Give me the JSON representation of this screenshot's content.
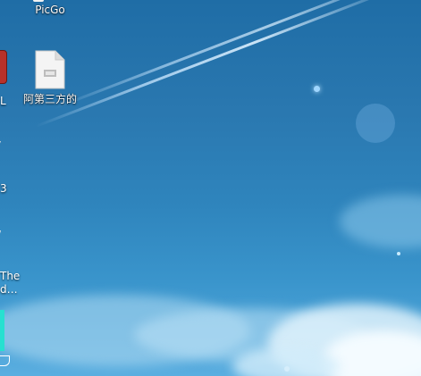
{
  "desktop": {
    "icons": [
      {
        "label": "PicGo",
        "icon": "picgo-icon"
      },
      {
        "label": "阿第三方的",
        "icon": "file-document-icon"
      }
    ],
    "partial_labels": [
      "L",
      "3",
      "The",
      "d…"
    ]
  },
  "colors": {
    "sky_top": "#1f6da6",
    "sky_bottom": "#5aaee0",
    "app_icon_red": "#b8312a",
    "app_icon_cyan": "#27e0d0"
  }
}
